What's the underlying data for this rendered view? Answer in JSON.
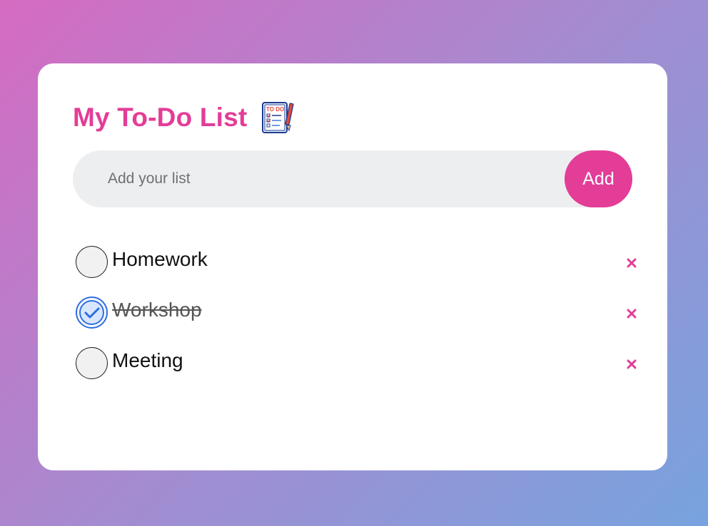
{
  "app": {
    "title": "My To-Do List",
    "title_icon": "todo-notepad-icon",
    "accent_color": "#e33d98",
    "check_color": "#2f6fe0"
  },
  "input": {
    "placeholder": "Add your list",
    "value": ""
  },
  "add_button": {
    "label": "Add"
  },
  "tasks": [
    {
      "label": "Homework",
      "completed": false
    },
    {
      "label": "Workshop",
      "completed": true
    },
    {
      "label": "Meeting",
      "completed": false
    }
  ],
  "delete_icon": "close-icon"
}
